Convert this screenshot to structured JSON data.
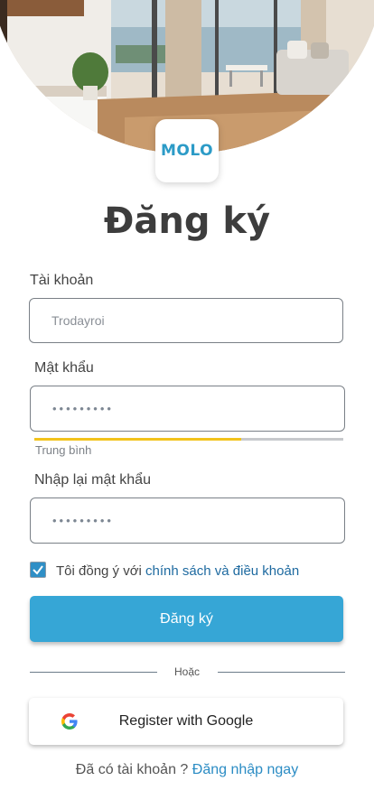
{
  "logo": {
    "text": "MOLO"
  },
  "page": {
    "title": "Đăng ký"
  },
  "form": {
    "account": {
      "label": "Tài khoản",
      "value": "Trodayroi"
    },
    "password": {
      "label": "Mật khẩu",
      "value": "•••••••••"
    },
    "strength": {
      "text": "Trung bình",
      "level": 0.67,
      "color": "#f2c31c"
    },
    "confirm": {
      "label": "Nhập lại mật khẩu",
      "value": "•••••••••"
    },
    "agree": {
      "checked": true,
      "text": "Tôi đồng ý với ",
      "link": "chính sách và điều khoản"
    },
    "submit_label": "Đăng ký"
  },
  "or_text": "Hoặc",
  "google": {
    "label": "Register with Google"
  },
  "footer": {
    "text": "Đã có tài khoản ? ",
    "link": "Đăng nhập ngay"
  },
  "colors": {
    "primary": "#36a6d6",
    "link": "#1e6aa0",
    "brand": "#2c9bc7"
  },
  "icons": {
    "logo": "molo-logo-icon",
    "checkbox": "checkmark-icon",
    "google": "google-g-icon"
  }
}
